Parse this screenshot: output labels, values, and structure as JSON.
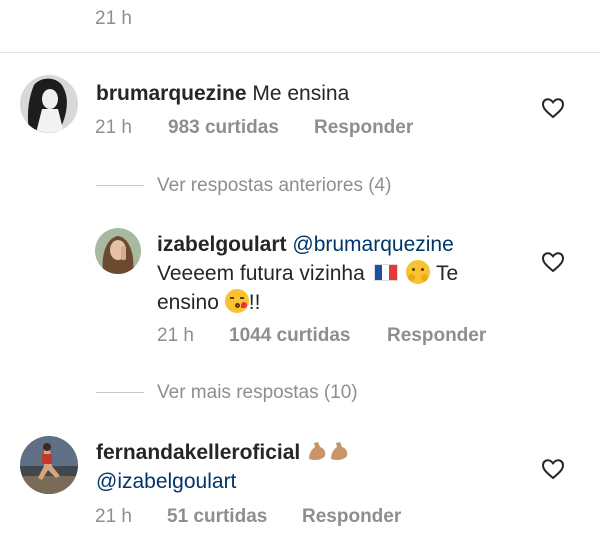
{
  "top": {
    "time": "21 h"
  },
  "comments": [
    {
      "username": "brumarquezine",
      "text": "Me ensina",
      "time": "21 h",
      "likes": "983 curtidas",
      "reply_label": "Responder"
    },
    {
      "username": "izabelgoulart",
      "mention": "@brumarquezine",
      "text_line1": "Veeeem futura vizinha",
      "text_line1_end": "Te",
      "text_line2": "ensino",
      "text_line2_end": "!!",
      "time": "21 h",
      "likes": "1044 curtidas",
      "reply_label": "Responder"
    },
    {
      "username": "fernandakelleroficial",
      "mention": "@izabelgoulart",
      "time": "21 h",
      "likes": "51 curtidas",
      "reply_label": "Responder"
    }
  ],
  "thread": {
    "previous_replies": "Ver respostas anteriores (4)",
    "more_replies": "Ver mais respostas (10)"
  },
  "icons": {
    "like": "heart-outline-icon",
    "flag": "france-flag-emoji",
    "hug": "hugging-face-emoji",
    "kiss": "kissing-face-emoji",
    "muscle": "flexed-biceps-emoji"
  },
  "colors": {
    "text": "#262626",
    "meta": "#8e8e8e",
    "mention": "#003569"
  }
}
